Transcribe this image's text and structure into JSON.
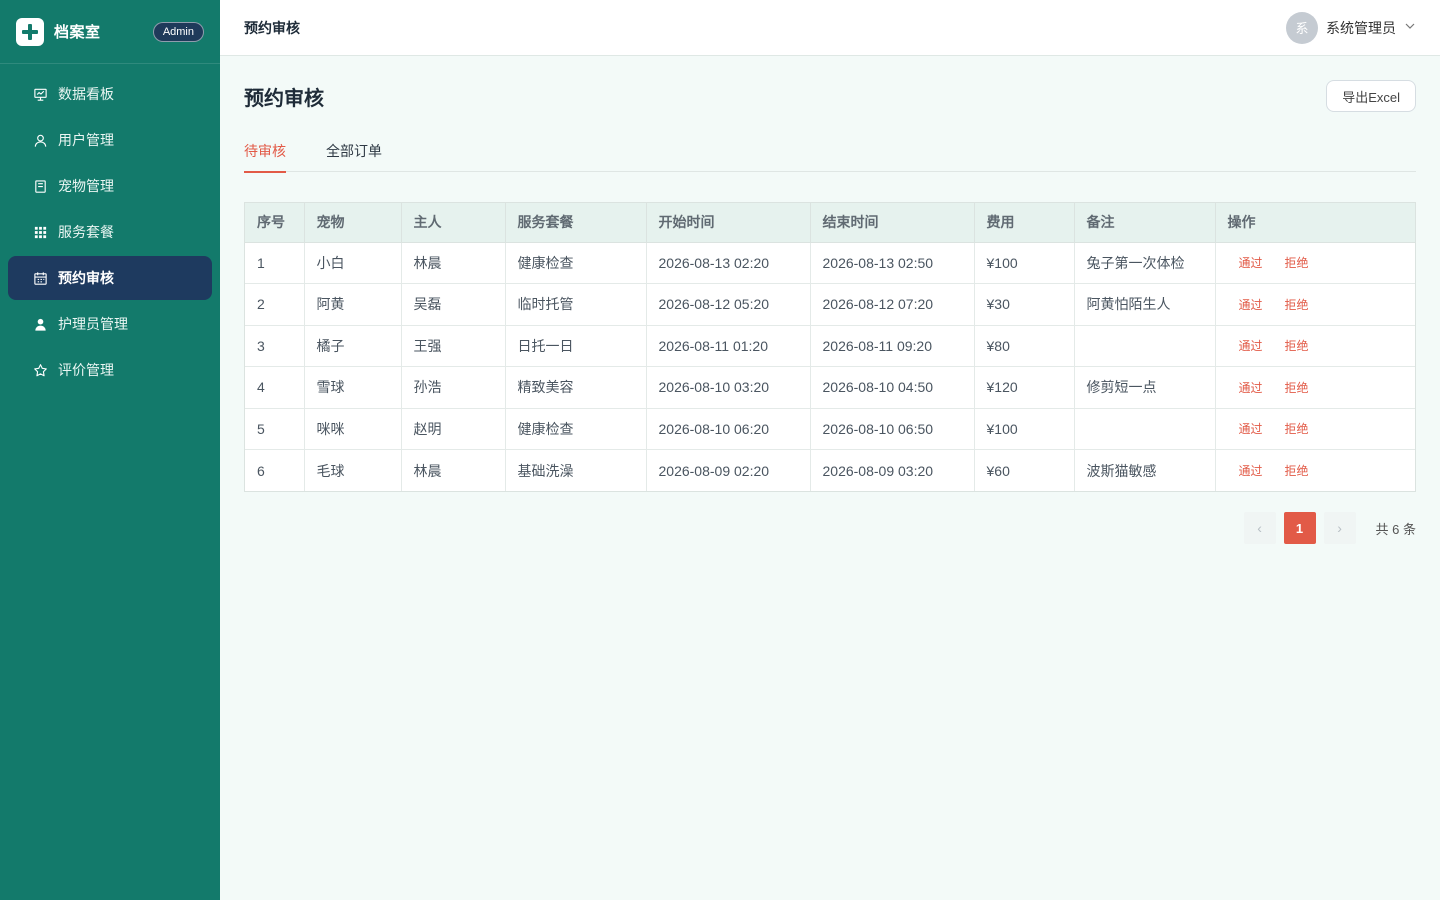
{
  "brand": {
    "name": "档案室",
    "badge": "Admin"
  },
  "sidebar": {
    "items": [
      {
        "label": "数据看板",
        "icon": "dashboard-icon",
        "active": false
      },
      {
        "label": "用户管理",
        "icon": "user-icon",
        "active": false
      },
      {
        "label": "宠物管理",
        "icon": "pet-icon",
        "active": false
      },
      {
        "label": "服务套餐",
        "icon": "grid-icon",
        "active": false
      },
      {
        "label": "预约审核",
        "icon": "calendar-icon",
        "active": true
      },
      {
        "label": "护理员管理",
        "icon": "caregiver-icon",
        "active": false
      },
      {
        "label": "评价管理",
        "icon": "star-icon",
        "active": false
      }
    ]
  },
  "header": {
    "title": "预约审核",
    "user_avatar": "系",
    "user_name": "系统管理员"
  },
  "main": {
    "title": "预约审核",
    "export_label": "导出Excel",
    "tabs": [
      {
        "label": "待审核",
        "active": true
      },
      {
        "label": "全部订单",
        "active": false
      }
    ]
  },
  "table": {
    "columns": [
      "序号",
      "宠物",
      "主人",
      "服务套餐",
      "开始时间",
      "结束时间",
      "费用",
      "备注",
      "操作"
    ],
    "rows": [
      {
        "no": "1",
        "pet": "小白",
        "owner": "林晨",
        "service": "健康检查",
        "start": "2026-08-13 02:20",
        "end": "2026-08-13 02:50",
        "fee": "¥100",
        "note": "兔子第一次体检"
      },
      {
        "no": "2",
        "pet": "阿黄",
        "owner": "吴磊",
        "service": "临时托管",
        "start": "2026-08-12 05:20",
        "end": "2026-08-12 07:20",
        "fee": "¥30",
        "note": "阿黄怕陌生人"
      },
      {
        "no": "3",
        "pet": "橘子",
        "owner": "王强",
        "service": "日托一日",
        "start": "2026-08-11 01:20",
        "end": "2026-08-11 09:20",
        "fee": "¥80",
        "note": ""
      },
      {
        "no": "4",
        "pet": "雪球",
        "owner": "孙浩",
        "service": "精致美容",
        "start": "2026-08-10 03:20",
        "end": "2026-08-10 04:50",
        "fee": "¥120",
        "note": "修剪短一点"
      },
      {
        "no": "5",
        "pet": "咪咪",
        "owner": "赵明",
        "service": "健康检查",
        "start": "2026-08-10 06:20",
        "end": "2026-08-10 06:50",
        "fee": "¥100",
        "note": ""
      },
      {
        "no": "6",
        "pet": "毛球",
        "owner": "林晨",
        "service": "基础洗澡",
        "start": "2026-08-09 02:20",
        "end": "2026-08-09 03:20",
        "fee": "¥60",
        "note": "波斯猫敏感"
      }
    ],
    "approve_label": "通过",
    "reject_label": "拒绝"
  },
  "pagination": {
    "current": "1",
    "total_text": "共 6 条",
    "prev": "‹",
    "next": "›"
  },
  "colors": {
    "sidebar": "#137a6b",
    "active_nav": "#1e3a5f",
    "accent": "#e25a47"
  }
}
